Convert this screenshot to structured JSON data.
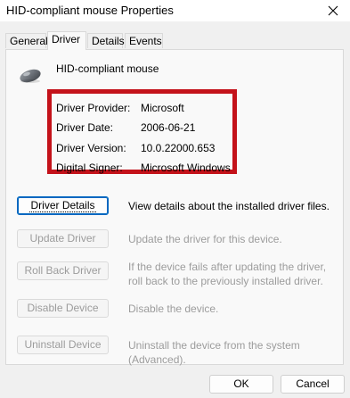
{
  "window": {
    "title": "HID-compliant mouse Properties",
    "close_label": "Close"
  },
  "tabs": [
    {
      "label": "General",
      "active": false
    },
    {
      "label": "Driver",
      "active": true
    },
    {
      "label": "Details",
      "active": false
    },
    {
      "label": "Events",
      "active": false
    }
  ],
  "device": {
    "name": "HID-compliant mouse",
    "icon": "mouse-icon"
  },
  "driver_info": [
    {
      "label": "Driver Provider:",
      "value": "Microsoft"
    },
    {
      "label": "Driver Date:",
      "value": "2006-06-21"
    },
    {
      "label": "Driver Version:",
      "value": "10.0.22000.653"
    },
    {
      "label": "Digital Signer:",
      "value": "Microsoft Windows"
    }
  ],
  "actions": [
    {
      "button": "Driver Details",
      "description": "View details about the installed driver files.",
      "enabled": true
    },
    {
      "button": "Update Driver",
      "description": "Update the driver for this device.",
      "enabled": false
    },
    {
      "button": "Roll Back Driver",
      "description": "If the device fails after updating the driver, roll back to the previously installed driver.",
      "enabled": false
    },
    {
      "button": "Disable Device",
      "description": "Disable the device.",
      "enabled": false
    },
    {
      "button": "Uninstall Device",
      "description": "Uninstall the device from the system (Advanced).",
      "enabled": false
    }
  ],
  "footer": {
    "ok_label": "OK",
    "cancel_label": "Cancel"
  },
  "colors": {
    "highlight_box": "#c4121a",
    "focus_accent": "#0067c0"
  }
}
